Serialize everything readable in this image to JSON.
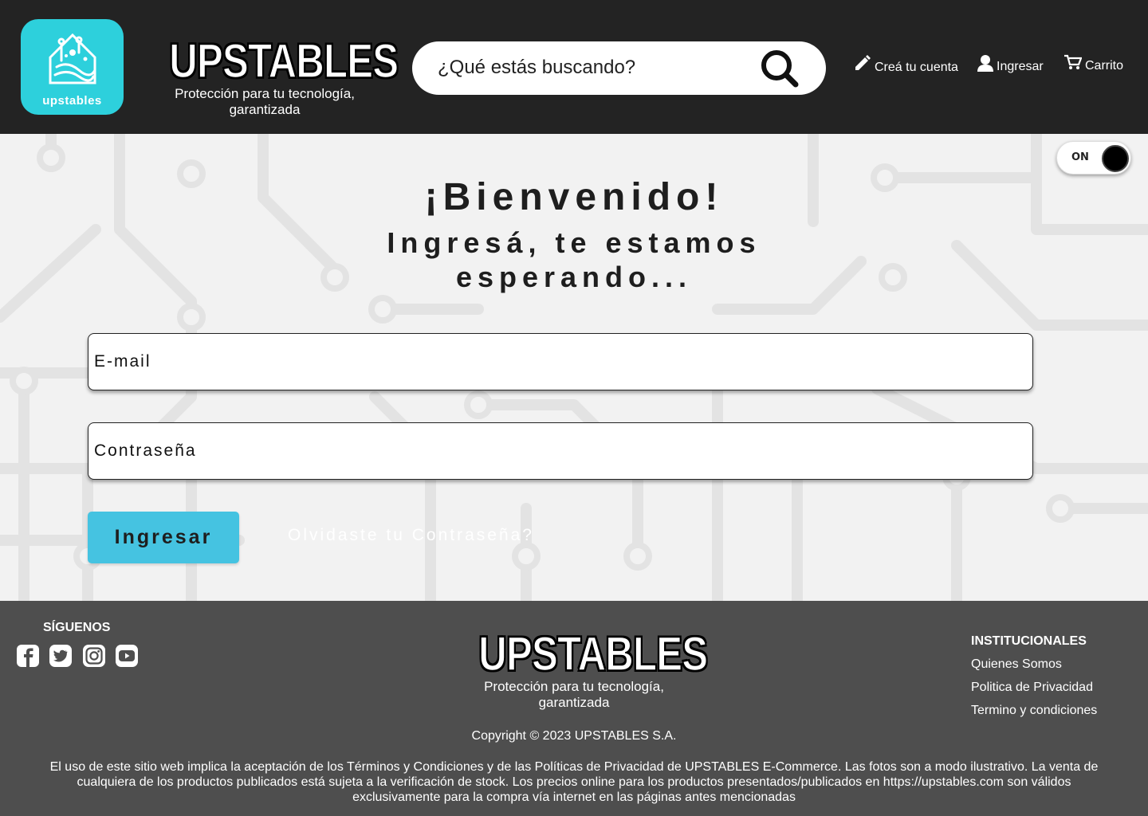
{
  "header": {
    "logo_text": "upstables",
    "brand_name": "UPSTABLES",
    "tagline": "Protección para tu tecnología, garantizada",
    "search": {
      "placeholder": "¿Qué estás buscando?"
    },
    "nav": {
      "create_account": "Creá tu cuenta",
      "login": "Ingresar",
      "cart": "Carrito"
    }
  },
  "main": {
    "theme_toggle_label": "ON",
    "welcome": "¡Bienvenido!",
    "subtitle": "Ingresá, te estamos esperando...",
    "email_placeholder": "E-mail",
    "password_placeholder": "Contraseña",
    "submit_label": "Ingresar",
    "forgot_link": "Olvidaste tu Contraseña?"
  },
  "footer": {
    "follow_title": "SÍGUENOS",
    "social_icons": [
      "facebook-icon",
      "twitter-icon",
      "instagram-icon",
      "youtube-icon"
    ],
    "brand_name": "UPSTABLES",
    "tagline": "Protección para tu tecnología, garantizada",
    "copyright": "Copyright © 2023 UPSTABLES S.A.",
    "legal": "El uso de este sitio web implica la aceptación de los Términos y Condiciones y de las Políticas de Privacidad de UPSTABLES E-Commerce. Las fotos son a modo ilustrativo. La venta de cualquiera de los productos publicados está sujeta a la verificación de stock. Los precios online para los productos presentados/publicados en https://upstables.com  son válidos exclusivamente para la compra vía internet en las páginas antes mencionadas",
    "institutional": {
      "title": "INSTITUCIONALES",
      "links": [
        "Quienes Somos",
        "Politica de Privacidad",
        "Termino y condiciones"
      ]
    }
  },
  "colors": {
    "header_bg": "#232323",
    "logo_teal": "#2dd0dc",
    "button_blue": "#45c3e1",
    "footer_bg": "#4e4e4e",
    "page_bg": "#f2f2f2"
  }
}
